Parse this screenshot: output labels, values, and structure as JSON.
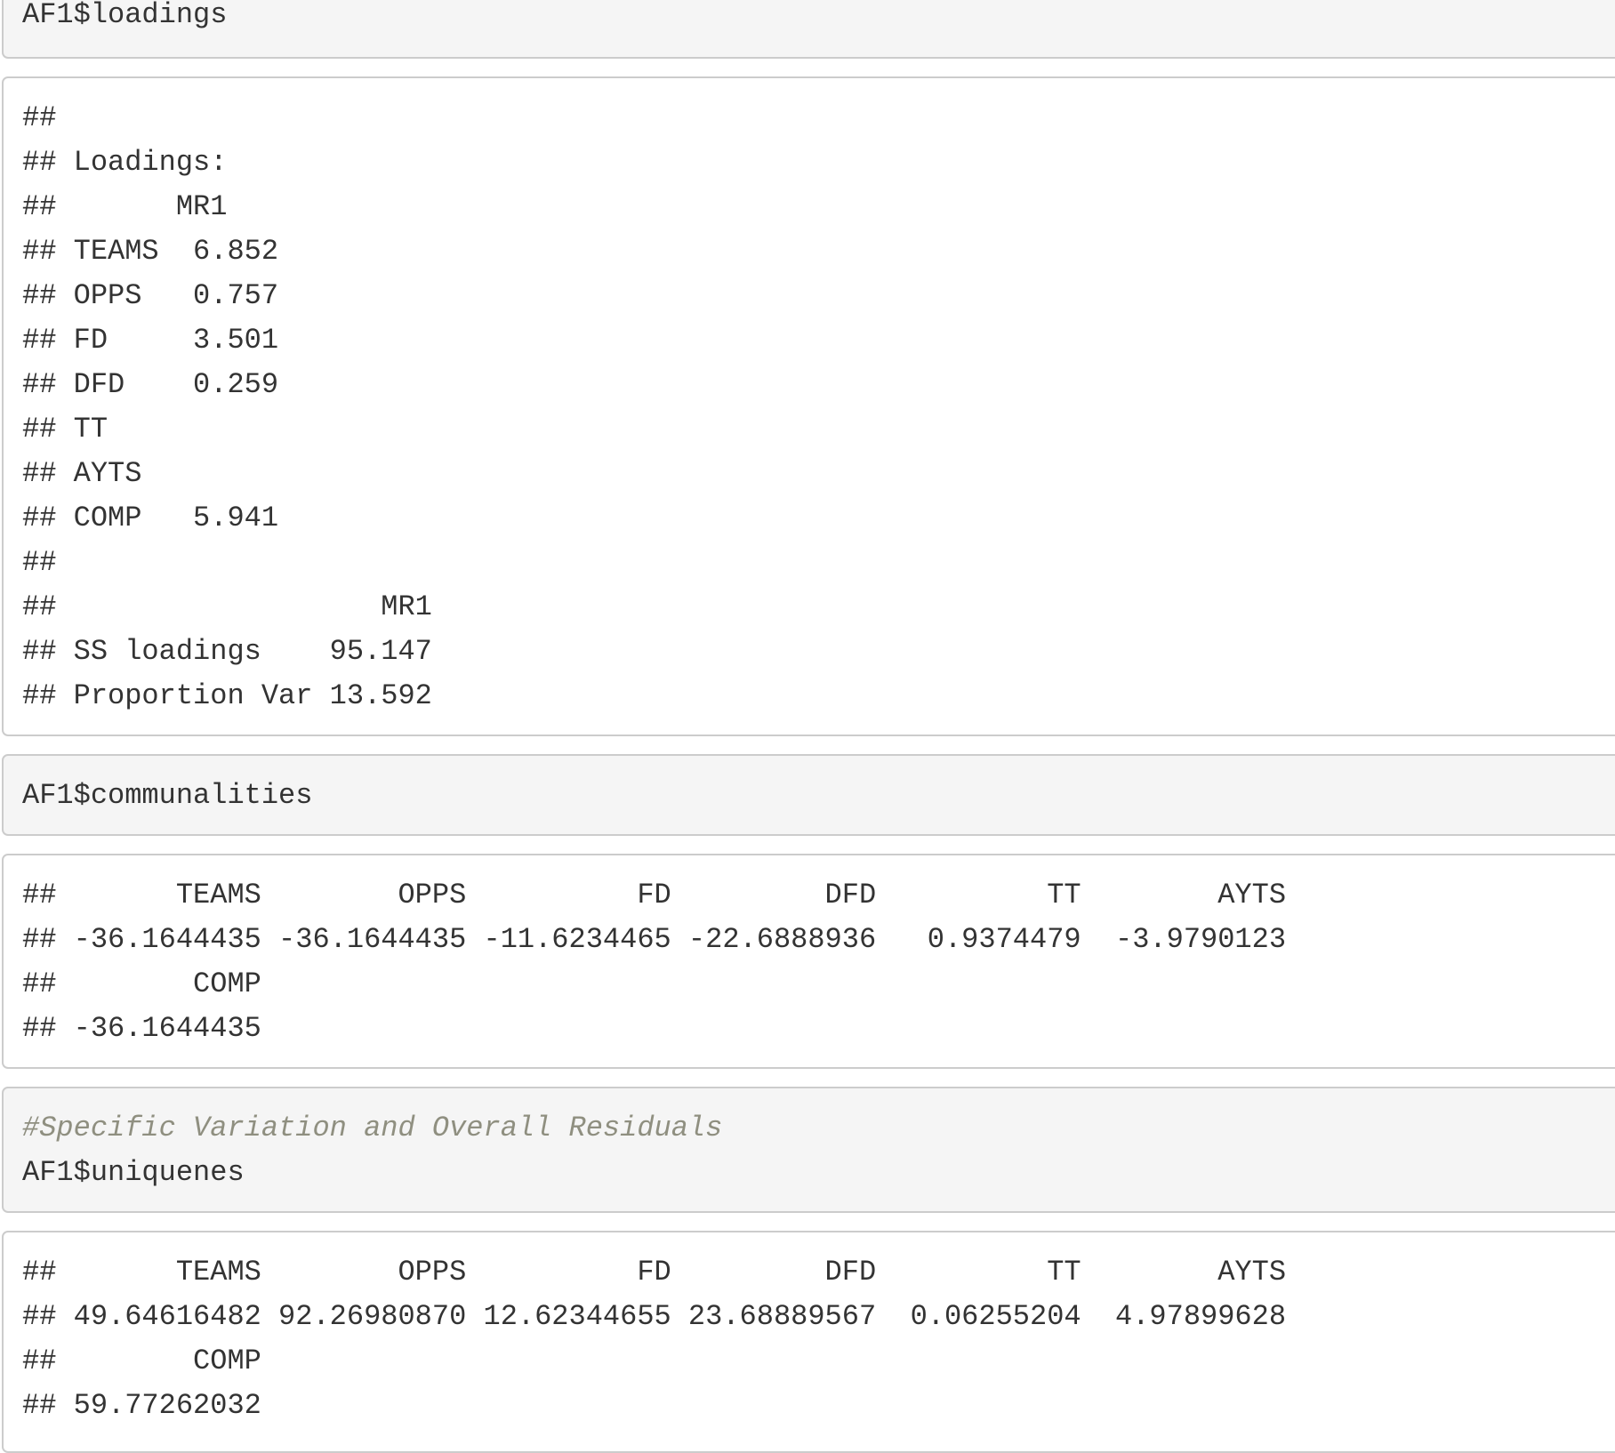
{
  "blocks": [
    {
      "kind": "source",
      "lines": [
        "AF1$loadings"
      ]
    },
    {
      "kind": "output",
      "lines": [
        "##",
        "## Loadings:",
        "##       MR1",
        "## TEAMS  6.852",
        "## OPPS   0.757",
        "## FD     3.501",
        "## DFD    0.259",
        "## TT",
        "## AYTS",
        "## COMP   5.941",
        "##",
        "##                   MR1",
        "## SS loadings    95.147",
        "## Proportion Var 13.592"
      ]
    },
    {
      "kind": "source",
      "lines": [
        "AF1$communalities"
      ]
    },
    {
      "kind": "output",
      "lines": [
        "##       TEAMS        OPPS          FD         DFD          TT        AYTS",
        "## -36.1644435 -36.1644435 -11.6234465 -22.6888936   0.9374479  -3.9790123",
        "##        COMP",
        "## -36.1644435"
      ]
    },
    {
      "kind": "source",
      "comment": "#Specific Variation and Overall Residuals",
      "lines": [
        "AF1$uniquenes"
      ]
    },
    {
      "kind": "output",
      "lines": [
        "##       TEAMS        OPPS          FD         DFD          TT        AYTS",
        "## 49.64616482 92.26980870 12.62344655 23.68889567  0.06255204  4.97899628",
        "##        COMP",
        "## 59.77262032"
      ]
    }
  ]
}
